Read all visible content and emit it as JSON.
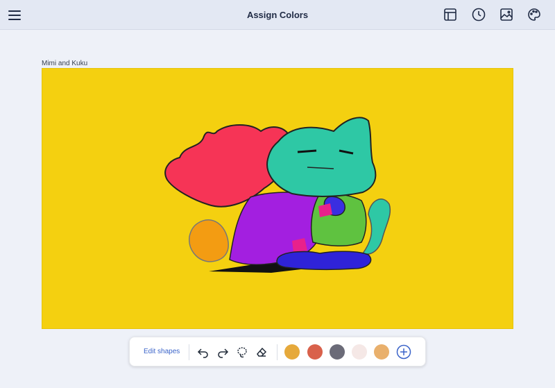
{
  "header": {
    "title": "Assign Colors",
    "icons": [
      "menu-icon",
      "layout-icon",
      "clock-icon",
      "image-icon",
      "palette-icon"
    ]
  },
  "canvas": {
    "label": "Mimi and Kuku",
    "background": "#f4d010"
  },
  "toolbar": {
    "edit_label": "Edit shapes",
    "tools": [
      "undo-icon",
      "redo-icon",
      "lasso-icon",
      "eraser-icon"
    ],
    "swatches": [
      "#e6a93b",
      "#d9614b",
      "#6b6b78",
      "#f5e8e6",
      "#e9b06c"
    ],
    "add_icon": "plus-circle-icon",
    "accent": "#3a63c9"
  }
}
